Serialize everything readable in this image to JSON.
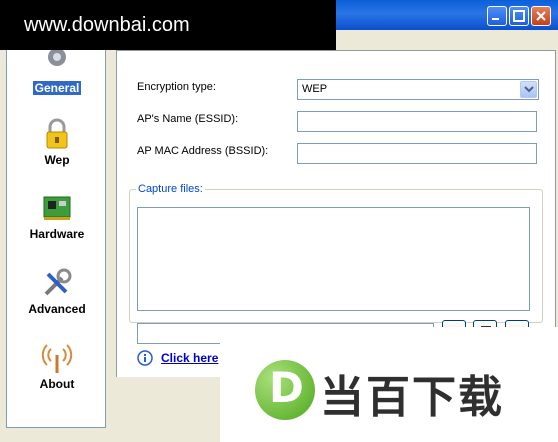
{
  "watermark": {
    "top_text": "www.downbai.com",
    "bottom_text": "当百下载",
    "bottom_letter": "D"
  },
  "sidebar": {
    "items": [
      {
        "label": "General",
        "icon": "gear-icon",
        "selected": true
      },
      {
        "label": "Wep",
        "icon": "lock-icon",
        "selected": false
      },
      {
        "label": "Hardware",
        "icon": "network-card-icon",
        "selected": false
      },
      {
        "label": "Advanced",
        "icon": "tools-icon",
        "selected": false
      },
      {
        "label": "About",
        "icon": "antenna-icon",
        "selected": false
      }
    ]
  },
  "form": {
    "encryption_label": "Encryption type:",
    "encryption_value": "WEP",
    "essid_label": "AP's Name (ESSID):",
    "essid_value": "",
    "bssid_label": "AP MAC Address (BSSID):",
    "bssid_value": "",
    "capture_label": "Capture files:",
    "capture_path": "",
    "help_link": "Click here"
  },
  "colors": {
    "selection": "#316ac5",
    "link": "#0000cc",
    "titlebar": "#0a5fd8"
  }
}
